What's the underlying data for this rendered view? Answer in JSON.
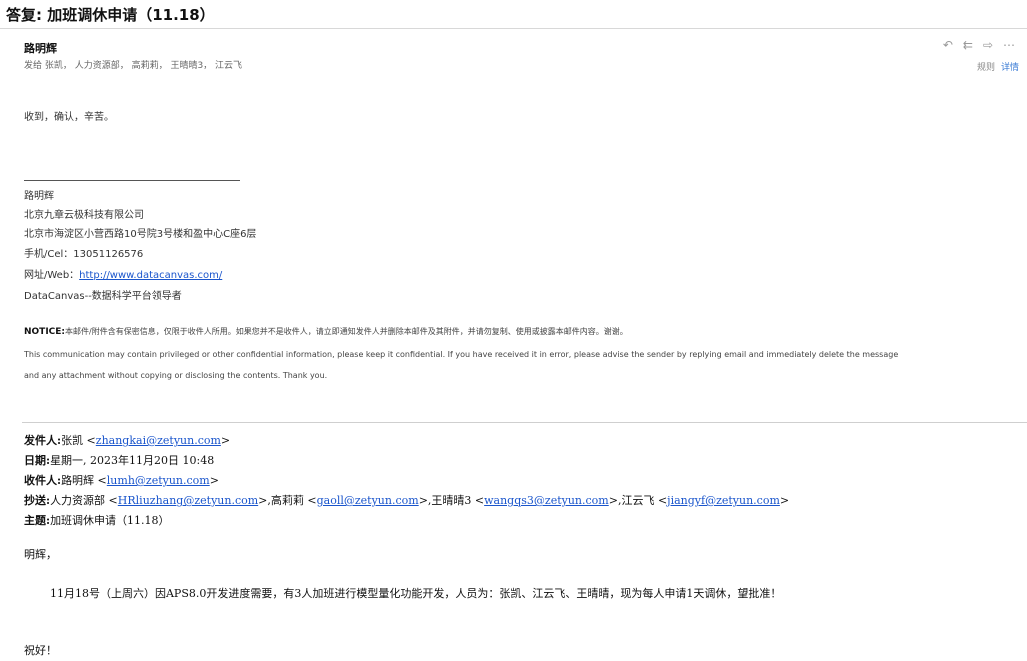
{
  "subject": "答复: 加班调休申请（11.18）",
  "header": {
    "sender_name": "路明辉",
    "recipients": "发给 张凯， 人力资源部， 高莉莉， 王晴晴3， 江云飞",
    "meta_left": "规则",
    "meta_right": "详情"
  },
  "reply": {
    "greeting": "收到，确认，辛苦。"
  },
  "signature": {
    "name": "路明辉",
    "company": "北京九章云极科技有限公司",
    "address": "北京市海淀区小营西路10号院3号楼和盈中心C座6层",
    "phone": "手机/Cel：13051126576",
    "web_label": "网址/Web：",
    "web_url": "http://www.datacanvas.com/",
    "tagline": "DataCanvas--数据科学平台领导者"
  },
  "notice": {
    "label": "NOTICE:",
    "cn": "本邮件/附件含有保密信息，仅限于收件人所用。如果您并不是收件人，请立即通知发件人并删除本邮件及其附件，并请勿复制、使用或披露本邮件内容。谢谢。",
    "en1": "This communication may contain privileged or other confidential information, please keep it confidential. If you have received it in error, please advise the sender by replying email and immediately delete the message",
    "en2": "and any attachment without copying or disclosing the contents. Thank you."
  },
  "forwarded": {
    "from_label": "发件人:",
    "from_name": "张凯 <",
    "from_email": "zhangkai@zetyun.com",
    "from_end": ">",
    "date_label": "日期:",
    "date": "星期一, 2023年11月20日 10:48",
    "to_label": "收件人:",
    "to_name": "路明辉 <",
    "to_email": "lumh@zetyun.com",
    "to_end": ">",
    "cc_label": "抄送:",
    "cc_1_name": "人力资源部 <",
    "cc_1_email": "HRliuzhang@zetyun.com",
    "cc_2_name": ">,高莉莉 <",
    "cc_2_email": "gaoll@zetyun.com",
    "cc_3_name": ">,王晴晴3 <",
    "cc_3_email": "wangqs3@zetyun.com",
    "cc_4_name": ">,江云飞 <",
    "cc_4_email": "jiangyf@zetyun.com",
    "cc_end": ">",
    "subject_label": "主题:",
    "subject": "加班调休申请（11.18）",
    "salutation": "明辉，",
    "body": "11月18号（上周六）因APS8.0开发进度需要，有3人加班进行模型量化功能开发，人员为：张凯、江云飞、王晴晴，现为每人申请1天调休，望批准！",
    "closing": "祝好！"
  }
}
